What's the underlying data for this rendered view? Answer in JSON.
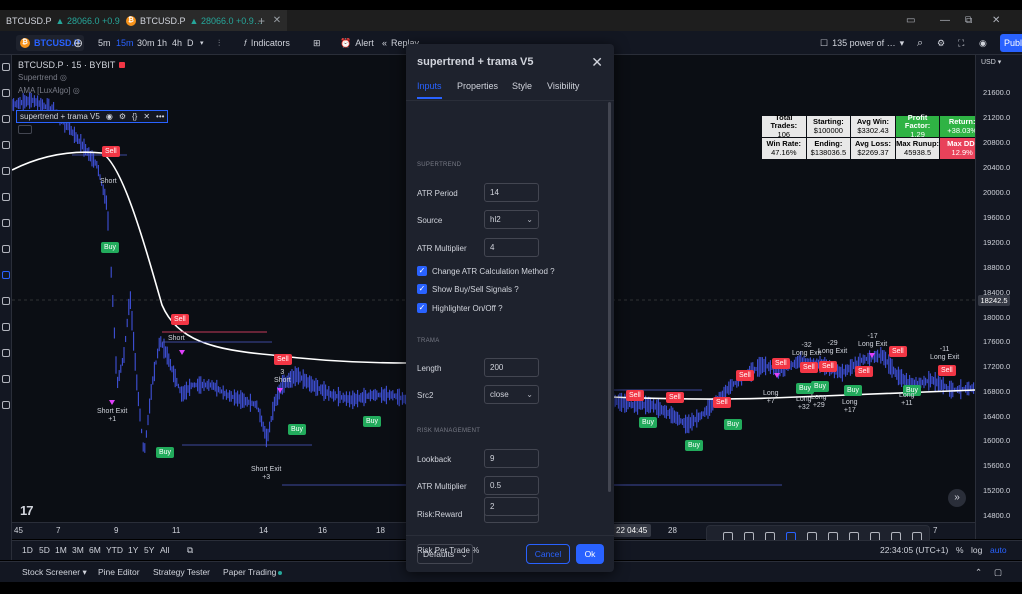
{
  "browser": {
    "tabs": [
      {
        "label": "BTCUSD.P",
        "price": "28066.0",
        "change": "+0.9…"
      },
      {
        "label": "BTCUSD.P",
        "price": "28066.0",
        "change": "+0.9…"
      }
    ],
    "new_tab": "+"
  },
  "toolbar": {
    "notifications": "11",
    "symbol": "BTCUSD.P",
    "intervals": [
      "5m",
      "15m",
      "30m",
      "1h",
      "4h",
      "D"
    ],
    "active_interval": "15m",
    "indicators_label": "Indicators",
    "alert_label": "Alert",
    "replay_label": "Replay",
    "layout_name": "135 power of …",
    "publish_label": "Publ"
  },
  "chart": {
    "title": "BTCUSD.P · 15 · BYBIT",
    "indicator_1": "Supertrend",
    "indicator_2": "AMA [LuxAlgo]",
    "indicator_3": "supertrend + trama V5",
    "logo": "17",
    "labels": {
      "sell": "Sell",
      "buy": "Buy",
      "short": "Short",
      "short_exit_1": "Short Exit\n+1",
      "short_exit_3": "Short Exit\n+3",
      "short_3": "3\nShort",
      "long_exit_32": "-32\nLong Exit",
      "long_exit_29": "-29\nLong Exit",
      "long_exit_17": "-17\nLong Exit",
      "long_exit_11": "-11\nLong Exit",
      "long_7": "Long\n+7",
      "long_32": "Long\n+32",
      "long_29": "Long\n+29",
      "long_17": "Long\n+17",
      "long_11": "Long\n+11"
    }
  },
  "stats": [
    {
      "label": "Total Trades:",
      "value": "106",
      "tone": "neutral"
    },
    {
      "label": "Starting:",
      "value": "$100000",
      "tone": "neutral"
    },
    {
      "label": "Avg Win:",
      "value": "$3302.43",
      "tone": "neutral"
    },
    {
      "label": "Profit Factor:",
      "value": "1.29",
      "tone": "green"
    },
    {
      "label": "Return:",
      "value": "+38.03%",
      "tone": "green"
    },
    {
      "label": "Win Rate:",
      "value": "47.16%",
      "tone": "neutral"
    },
    {
      "label": "Ending:",
      "value": "$138036.5",
      "tone": "neutral"
    },
    {
      "label": "Avg Loss:",
      "value": "$2269.37",
      "tone": "neutral"
    },
    {
      "label": "Max Runup:",
      "value": "45938.5",
      "tone": "neutral"
    },
    {
      "label": "Max DD:",
      "value": "12.9%",
      "tone": "red"
    }
  ],
  "price_scale": {
    "currency": "USD",
    "levels": [
      "21600.0",
      "21200.0",
      "20800.0",
      "20400.0",
      "20000.0",
      "19600.0",
      "19200.0",
      "18800.0",
      "18400.0",
      "18000.0",
      "17600.0",
      "17200.0",
      "16800.0",
      "16400.0",
      "16000.0",
      "15600.0",
      "15200.0",
      "14800.0"
    ],
    "current": "18242.5"
  },
  "time_axis": {
    "ticks": [
      "45",
      "7",
      "9",
      "11",
      "14",
      "16",
      "18",
      "28",
      "7"
    ],
    "highlight": "22  04:45"
  },
  "range_bar": {
    "ranges": [
      "1D",
      "5D",
      "1M",
      "3M",
      "6M",
      "YTD",
      "1Y",
      "5Y",
      "All"
    ],
    "clock": "22:34:05 (UTC+1)",
    "pct": "%",
    "log": "log",
    "auto": "auto"
  },
  "footer": {
    "tabs": [
      "Stock Screener",
      "Pine Editor",
      "Strategy Tester",
      "Paper Trading"
    ]
  },
  "modal": {
    "title": "supertrend + trama V5",
    "tabs": [
      "Inputs",
      "Properties",
      "Style",
      "Visibility"
    ],
    "active_tab": "Inputs",
    "sections": {
      "supertrend": "SUPERTREND",
      "trama": "TRAMA",
      "risk": "RISK MANAGEMENT"
    },
    "fields": {
      "atr_period": {
        "label": "ATR Period",
        "value": "14"
      },
      "source": {
        "label": "Source",
        "value": "hl2"
      },
      "atr_multiplier": {
        "label": "ATR Multiplier",
        "value": "4"
      },
      "change_atr": {
        "label": "Change ATR Calculation Method ?",
        "checked": true
      },
      "show_signals": {
        "label": "Show Buy/Sell Signals ?",
        "checked": true
      },
      "highlighter": {
        "label": "Highlighter On/Off ?",
        "checked": true
      },
      "length": {
        "label": "Length",
        "value": "200"
      },
      "src2": {
        "label": "Src2",
        "value": "close"
      },
      "lookback": {
        "label": "Lookback",
        "value": "9"
      },
      "atr_multiplier_2": {
        "label": "ATR Multiplier",
        "value": "0.5"
      },
      "risk_reward": {
        "label": "Risk:Reward",
        "value": "1.5"
      },
      "risk_per_trade": {
        "label": "Risk Per Trade %",
        "value": "2"
      }
    },
    "defaults_label": "Defaults",
    "cancel_label": "Cancel",
    "ok_label": "Ok"
  },
  "colors": {
    "accent": "#2962ff",
    "candles": "#3f51d8",
    "trend_line": "#ffffff",
    "sell": "#f23645",
    "buy": "#22ab5c"
  }
}
